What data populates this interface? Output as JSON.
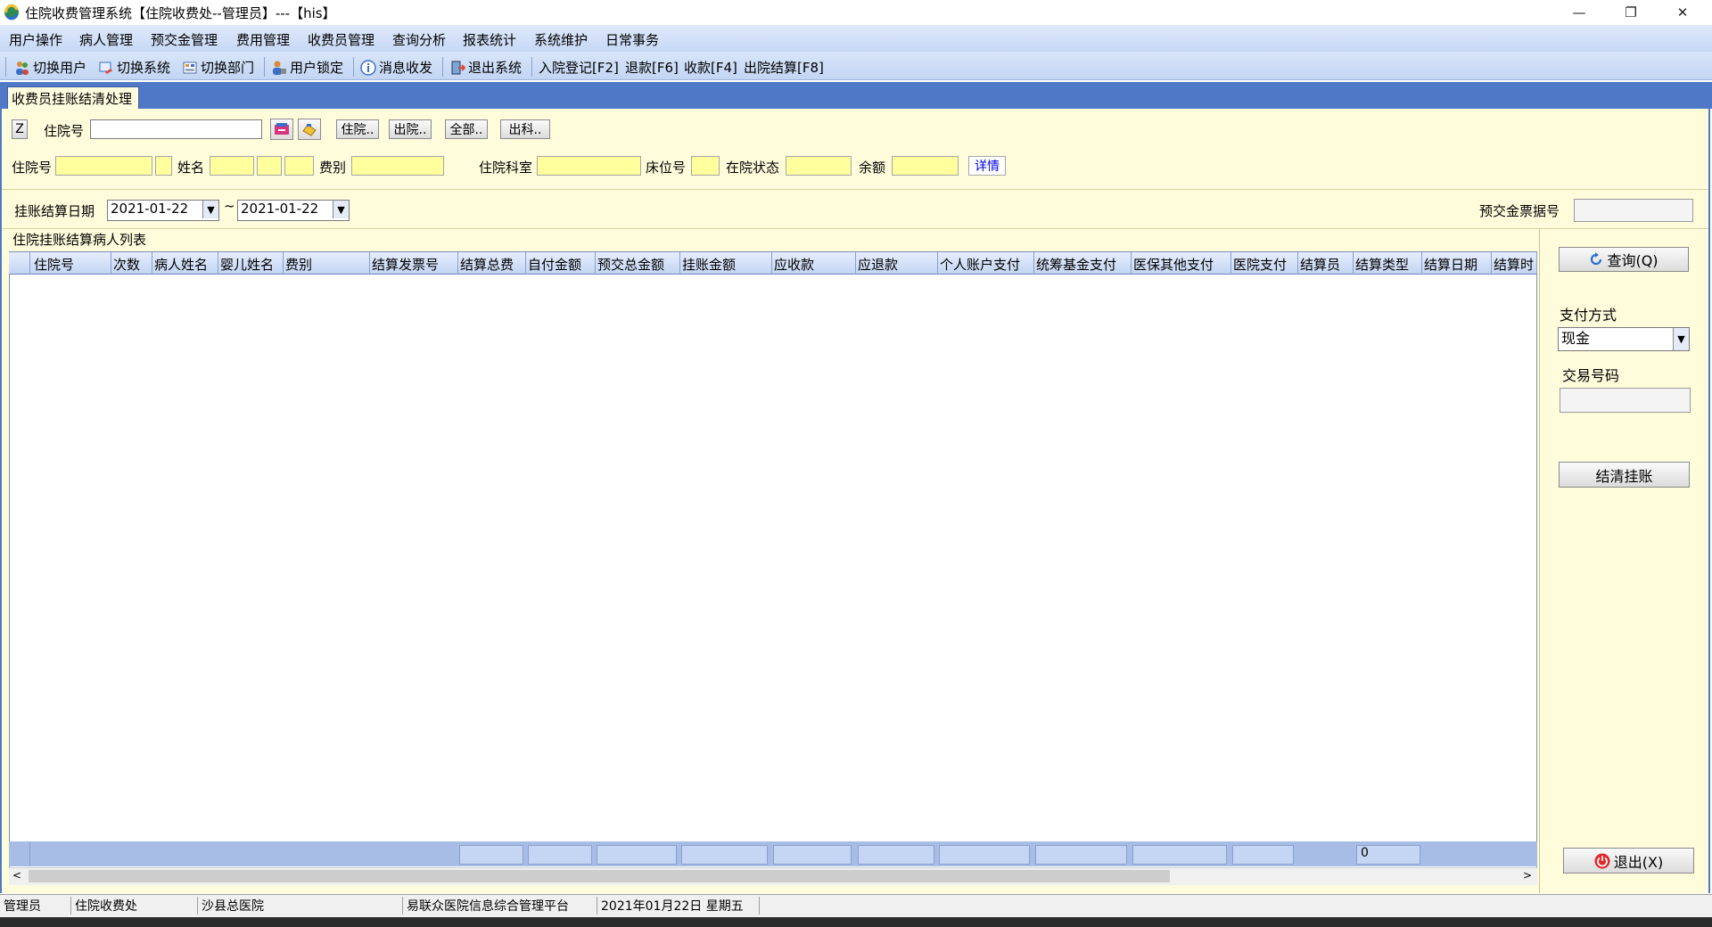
{
  "titlebar": {
    "title": "住院收费管理系统【住院收费处--管理员】---【his】",
    "minimize": "—",
    "restore": "❐",
    "close": "✕"
  },
  "menu": [
    "用户操作",
    "病人管理",
    "预交金管理",
    "费用管理",
    "收费员管理",
    "查询分析",
    "报表统计",
    "系统维护",
    "日常事务"
  ],
  "toolbar": {
    "switch_user": "切换用户",
    "switch_system": "切换系统",
    "switch_dept": "切换部门",
    "user_lock": "用户锁定",
    "message": "消息收发",
    "exit_system": "退出系统",
    "admission": "入院登记[F2]",
    "refund": "退款[F6]",
    "collect": "收款[F4]",
    "discharge": "出院结算[F8]"
  },
  "tab": {
    "label": "收费员挂账结清处理"
  },
  "search": {
    "z_label": "Z",
    "inpatient_no_label": "住院号",
    "inpatient_no_value": "",
    "btn_in": "住院..",
    "btn_out": "出院..",
    "btn_all": "全部..",
    "btn_dept": "出科.."
  },
  "patient": {
    "inpatient_no_label": "住院号",
    "name_label": "姓名",
    "fee_type_label": "费别",
    "dept_label": "住院科室",
    "bed_label": "床位号",
    "status_label": "在院状态",
    "balance_label": "余额",
    "detail_link": "详情"
  },
  "date_filter": {
    "label": "挂账结算日期",
    "from": "2021-01-22",
    "sep": "~",
    "to": "2021-01-22",
    "receipt_label": "预交金票据号",
    "receipt_value": ""
  },
  "grid": {
    "title": "住院挂账结算病人列表",
    "columns": [
      "住院号",
      "次数",
      "病人姓名",
      "婴儿姓名",
      "费别",
      "结算发票号",
      "结算总费",
      "自付金额",
      "预交总金额",
      "挂账金额",
      "应收款",
      "应退款",
      "个人账户支付",
      "统筹基金支付",
      "医保其他支付",
      "医院支付",
      "结算员",
      "结算类型",
      "结算日期",
      "结算时"
    ],
    "footer_count": "0"
  },
  "side": {
    "query_button": "查询(Q)",
    "payment_label": "支付方式",
    "payment_value": "现金",
    "trans_label": "交易号码",
    "trans_value": "",
    "settle_button": "结清挂账",
    "exit_button": "退出(X)"
  },
  "status": {
    "user": "管理员",
    "dept": "住院收费处",
    "hospital": "沙县总医院",
    "platform": "易联众医院信息综合管理平台",
    "date": "2021年01月22日 星期五"
  },
  "colors": {
    "accent": "#4f79c7",
    "panel": "#fffcdc",
    "input_yellow": "#ffff9e"
  }
}
